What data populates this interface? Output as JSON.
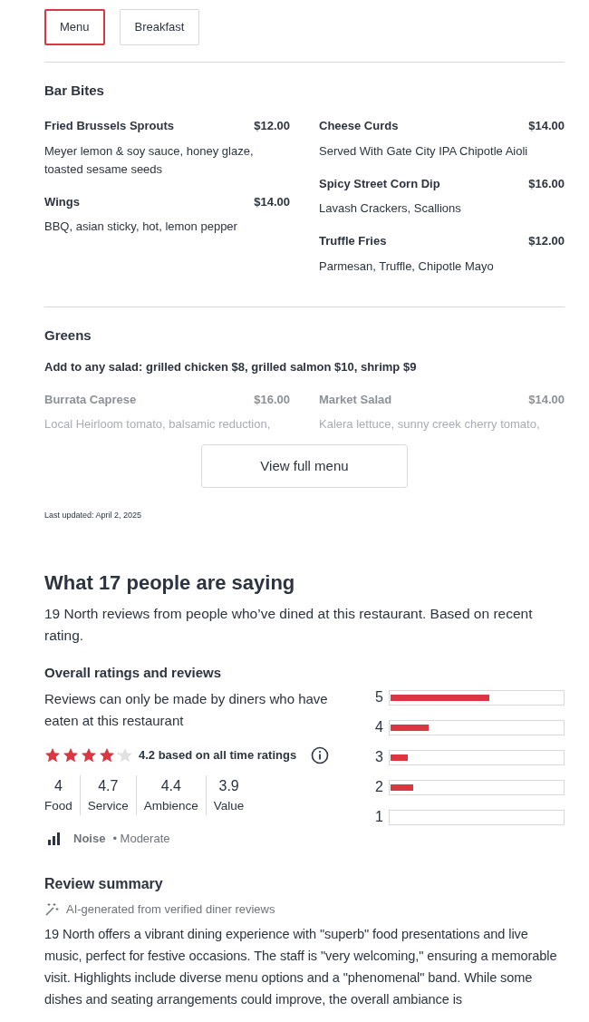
{
  "menu_tabs": [
    {
      "label": "Menu",
      "selected": true
    },
    {
      "label": "Breakfast",
      "selected": false
    }
  ],
  "sections": [
    {
      "title": "Bar Bites",
      "faded": false,
      "columns": [
        [
          {
            "name": "Fried Brussels Sprouts",
            "price": "$12.00",
            "description": "Meyer lemon & soy sauce, honey glaze, toasted sesame seeds"
          },
          {
            "name": "Wings",
            "price": "$14.00",
            "description": "BBQ, asian sticky, hot, lemon pepper"
          }
        ],
        [
          {
            "name": "Cheese Curds",
            "price": "$14.00",
            "description": "Served With Gate City IPA Chipotle Aioli"
          },
          {
            "name": "Spicy Street Corn Dip",
            "price": "$16.00",
            "description": "Lavash Crackers, Scallions"
          },
          {
            "name": "Truffle Fries",
            "price": "$12.00",
            "description": "Parmesan, Truffle, Chipotle Mayo"
          }
        ]
      ]
    },
    {
      "title": "Greens",
      "note": "Add to any salad: grilled chicken $8, grilled salmon $10, shrimp $9",
      "faded": true,
      "columns": [
        [
          {
            "name": "Burrata Caprese",
            "price": "$16.00",
            "description": "Local Heirloom tomato, balsamic reduction,"
          }
        ],
        [
          {
            "name": "Market Salad",
            "price": "$14.00",
            "description": "Kalera lettuce, sunny creek cherry tomato,"
          }
        ]
      ]
    }
  ],
  "view_full_menu": "View full menu",
  "last_updated": "Last updated: April 2, 2025",
  "reviews": {
    "heading": "What 17 people are saying",
    "intro": "19 North reviews from people who’ve dined at this restaurant. Based on recent rating.",
    "overall_title": "Overall ratings and reviews",
    "overall_note": "Reviews can only be made by diners who have eaten at this restaurant",
    "stars": 4.2,
    "rating_text": "4.2 based on all time ratings",
    "categories": [
      {
        "value": "4",
        "label": "Food"
      },
      {
        "value": "4.7",
        "label": "Service"
      },
      {
        "value": "4.4",
        "label": "Ambience"
      },
      {
        "value": "3.9",
        "label": "Value"
      }
    ],
    "noise_label": "Noise",
    "noise_value": "• Moderate",
    "distribution": [
      {
        "label": "5",
        "level": 0.57
      },
      {
        "label": "4",
        "level": 0.22
      },
      {
        "label": "3",
        "level": 0.1
      },
      {
        "label": "2",
        "level": 0.13
      },
      {
        "label": "1"
      }
    ]
  },
  "summary": {
    "title": "Review summary",
    "ai_note": "AI-generated from verified diner reviews",
    "text": "19 North offers a vibrant dining experience with \"superb\" food presentations and live music, perfect for festive occasions. The staff is \"very welcoming,\" ensuring a memorable visit. Highlights include diverse menu options and a \"phenomenal\" band. While some dishes and seating arrangements could improve, the overall ambiance is"
  }
}
